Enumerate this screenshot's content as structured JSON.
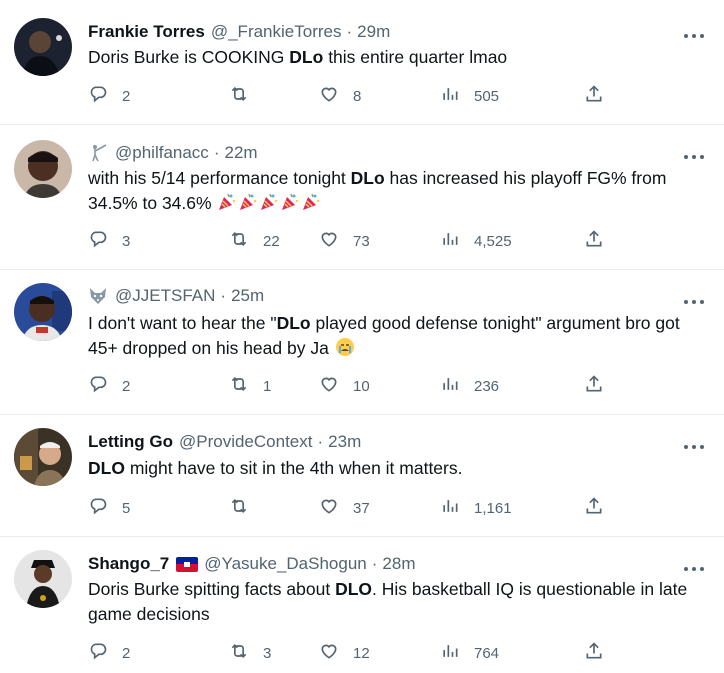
{
  "tweets": [
    {
      "name": "Frankie Torres",
      "handle": "@_FrankieTorres",
      "sep": "·",
      "time": "29m",
      "text": [
        {
          "t": "Doris Burke is COOKING "
        },
        {
          "t": "DLo",
          "b": true
        },
        {
          "t": " this entire quarter lmao"
        }
      ],
      "emojis": [],
      "replies": "2",
      "retweets": "",
      "likes": "8",
      "views": "505"
    },
    {
      "name": "",
      "handle": "@philfanacc",
      "sep": "·",
      "time": "22m",
      "lead_icon": "fencer-icon",
      "text": [
        {
          "t": "with his 5/14 performance tonight "
        },
        {
          "t": "DLo",
          "b": true
        },
        {
          "t": " has increased his playoff FG% from 34.5% to 34.6% "
        }
      ],
      "emojis": [
        "party-popper-icon",
        "party-popper-icon",
        "party-popper-icon",
        "party-popper-icon",
        "party-popper-icon"
      ],
      "replies": "3",
      "retweets": "22",
      "likes": "73",
      "views": "4,525"
    },
    {
      "name": "",
      "handle": "@JJETSFAN",
      "sep": "·",
      "time": "25m",
      "lead_icon": "wolf-icon",
      "text": [
        {
          "t": "I don't want to hear the \""
        },
        {
          "t": "DLo",
          "b": true
        },
        {
          "t": " played good defense tonight\" argument bro got 45+ dropped on his head by Ja "
        }
      ],
      "emojis": [
        "crying-face-icon"
      ],
      "replies": "2",
      "retweets": "1",
      "likes": "10",
      "views": "236"
    },
    {
      "name": "Letting Go",
      "handle": "@ProvideContext",
      "sep": "·",
      "time": "23m",
      "text": [
        {
          "t": "DLO",
          "b": true
        },
        {
          "t": " might have to sit in the 4th when it matters."
        }
      ],
      "emojis": [],
      "replies": "5",
      "retweets": "",
      "likes": "37",
      "views": "1,161"
    },
    {
      "name": "Shango_7",
      "flag": "haiti-flag-icon",
      "handle": "@Yasuke_DaShogun",
      "sep": "·",
      "time": "28m",
      "text": [
        {
          "t": "Doris Burke spitting facts about "
        },
        {
          "t": "DLO",
          "b": true
        },
        {
          "t": ". His basketball IQ is questionable in late game decisions"
        }
      ],
      "emojis": [],
      "replies": "2",
      "retweets": "3",
      "likes": "12",
      "views": "764"
    }
  ],
  "colors": {
    "text": "#0f1419",
    "secondary": "#536471",
    "divider": "#e6ecf0",
    "party": "#e0245e",
    "flag_blue": "#00209f",
    "flag_red": "#d21034"
  },
  "icons": {
    "reply": "reply-icon",
    "retweet": "retweet-icon",
    "like": "heart-icon",
    "views": "views-icon",
    "share": "share-icon",
    "more": "more-icon"
  }
}
